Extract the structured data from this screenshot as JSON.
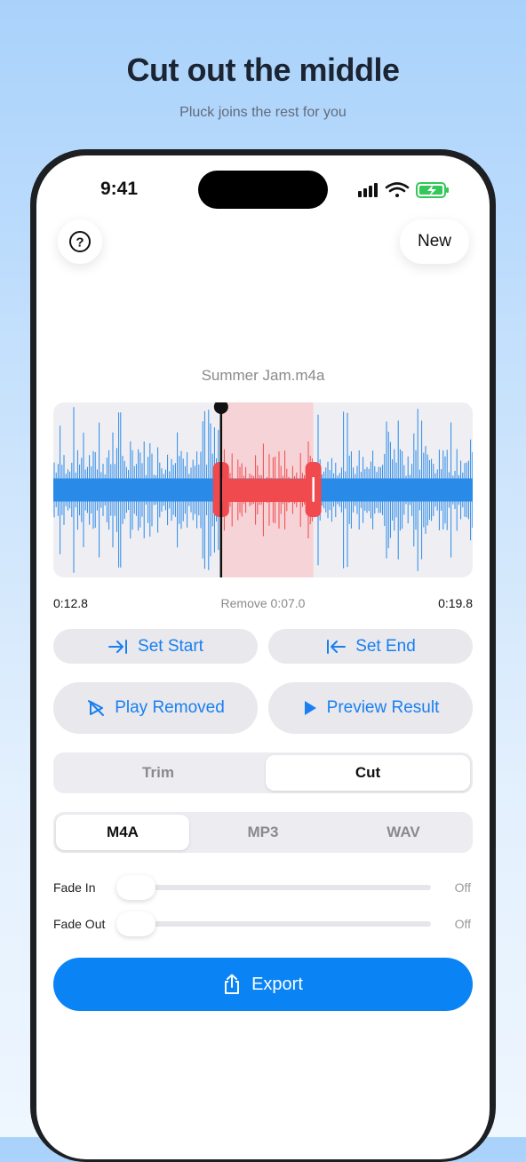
{
  "promo": {
    "headline": "Cut out the middle",
    "subhead": "Pluck joins the rest for you"
  },
  "status_bar": {
    "time": "9:41",
    "icons": [
      "signal-icon",
      "wifi-icon",
      "battery-charging-icon"
    ]
  },
  "header": {
    "help_icon": "question-circle-icon",
    "new_label": "New"
  },
  "track": {
    "filename": "Summer Jam.m4a",
    "start_time": "0:12.8",
    "remove_label": "Remove 0:07.0",
    "end_time": "0:19.8",
    "selection_start_fraction": 0.4,
    "selection_end_fraction": 0.62,
    "playhead_fraction": 0.4
  },
  "actions": {
    "set_start": "Set Start",
    "set_end": "Set End",
    "play_removed": "Play Removed",
    "preview_result": "Preview Result"
  },
  "mode_tabs": {
    "items": [
      "Trim",
      "Cut"
    ],
    "selected": "Cut"
  },
  "format_tabs": {
    "items": [
      "M4A",
      "MP3",
      "WAV"
    ],
    "selected": "M4A"
  },
  "fades": {
    "fade_in_label": "Fade In",
    "fade_in_value": "Off",
    "fade_out_label": "Fade Out",
    "fade_out_value": "Off"
  },
  "export": {
    "label": "Export"
  },
  "colors": {
    "accent": "#0a84f5",
    "waveform": "#2a8ae8",
    "selection": "#f04a4f",
    "selection_fill": "#f6d3d6"
  }
}
